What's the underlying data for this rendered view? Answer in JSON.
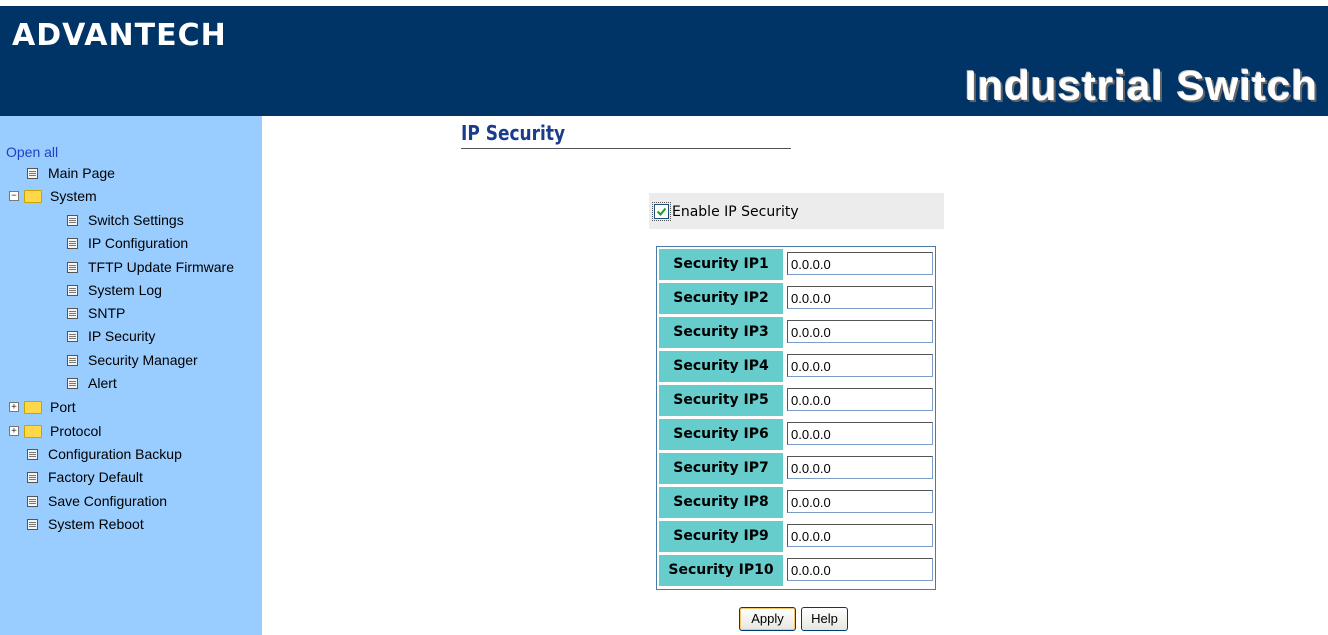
{
  "header": {
    "logo_text": "ADVANTECH",
    "product_title": "Industrial Switch",
    "bg_color": "#003366"
  },
  "sidebar": {
    "bg_color": "#99ccff",
    "open_all": "Open all",
    "items": [
      {
        "label": "Main Page",
        "icon": "page-icon"
      },
      {
        "label": "System",
        "icon": "folder-open-icon",
        "expander": "−"
      },
      {
        "label": "Switch Settings",
        "icon": "page-icon"
      },
      {
        "label": "IP Configuration",
        "icon": "page-icon"
      },
      {
        "label": "TFTP Update Firmware",
        "icon": "page-icon"
      },
      {
        "label": "System Log",
        "icon": "page-icon"
      },
      {
        "label": "SNTP",
        "icon": "page-icon"
      },
      {
        "label": "IP Security",
        "icon": "page-icon"
      },
      {
        "label": "Security Manager",
        "icon": "page-icon"
      },
      {
        "label": "Alert",
        "icon": "page-icon"
      },
      {
        "label": "Port",
        "icon": "folder-icon",
        "expander": "+"
      },
      {
        "label": "Protocol",
        "icon": "folder-icon",
        "expander": "+"
      },
      {
        "label": "Configuration Backup",
        "icon": "page-icon"
      },
      {
        "label": "Factory Default",
        "icon": "page-icon"
      },
      {
        "label": "Save Configuration",
        "icon": "page-icon"
      },
      {
        "label": "System Reboot",
        "icon": "page-icon"
      }
    ]
  },
  "main": {
    "title": "IP Security",
    "enable_checkbox": {
      "label": "Enable IP Security",
      "checked": true
    },
    "table_label_color": "#66cccc",
    "rows": [
      {
        "label": "Security IP1",
        "value": "0.0.0.0"
      },
      {
        "label": "Security IP2",
        "value": "0.0.0.0"
      },
      {
        "label": "Security IP3",
        "value": "0.0.0.0"
      },
      {
        "label": "Security IP4",
        "value": "0.0.0.0"
      },
      {
        "label": "Security IP5",
        "value": "0.0.0.0"
      },
      {
        "label": "Security IP6",
        "value": "0.0.0.0"
      },
      {
        "label": "Security IP7",
        "value": "0.0.0.0"
      },
      {
        "label": "Security IP8",
        "value": "0.0.0.0"
      },
      {
        "label": "Security IP9",
        "value": "0.0.0.0"
      },
      {
        "label": "Security IP10",
        "value": "0.0.0.0"
      }
    ],
    "apply_label": "Apply",
    "help_label": "Help"
  }
}
